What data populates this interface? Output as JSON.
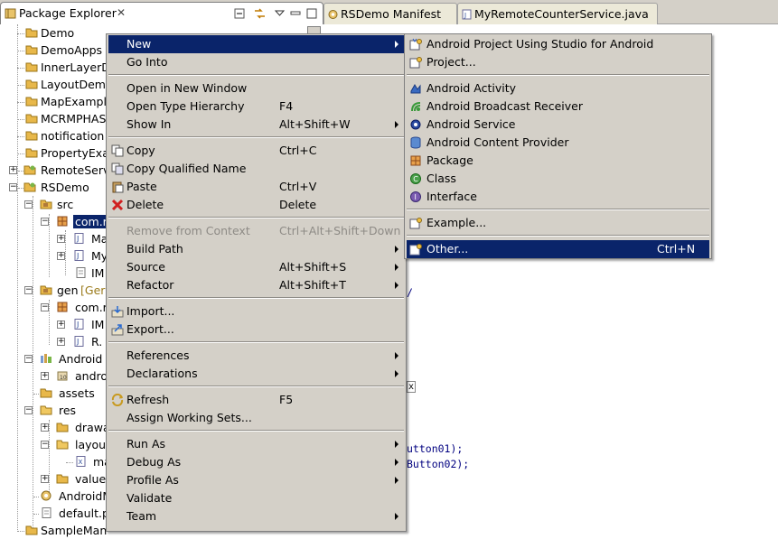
{
  "tabs": {
    "package_explorer": "Package Explorer",
    "close_glyph": "✕",
    "editor_tabs": [
      "RSDemo Manifest",
      "MyRemoteCounterService.java"
    ]
  },
  "tree": {
    "items": [
      {
        "label": "Demo"
      },
      {
        "label": "DemoApps"
      },
      {
        "label": "InnerLayerD"
      },
      {
        "label": "LayoutDemo"
      },
      {
        "label": "MapExample"
      },
      {
        "label": "MCRMPHASE"
      },
      {
        "label": "notification"
      },
      {
        "label": "PropertyExa"
      },
      {
        "label": "RemoteServ"
      },
      {
        "label": "RSDemo"
      },
      {
        "label": "src"
      },
      {
        "label": "com.r"
      },
      {
        "label": "Ma"
      },
      {
        "label": "My"
      },
      {
        "label": "IM"
      },
      {
        "label": "gen",
        "suffix": "[Ger"
      },
      {
        "label": "com.r"
      },
      {
        "label": "IM"
      },
      {
        "label": "R."
      },
      {
        "label": "Android :"
      },
      {
        "label": "andro"
      },
      {
        "label": "assets"
      },
      {
        "label": "res"
      },
      {
        "label": "drawa"
      },
      {
        "label": "layou"
      },
      {
        "label": "ma"
      },
      {
        "label": "values"
      },
      {
        "label": "AndroidM"
      },
      {
        "label": "default.p"
      },
      {
        "label": "SampleMan"
      }
    ]
  },
  "editor": {
    "code_lines": [
      "/",
      "x",
      "utton01);",
      "Button02);"
    ]
  },
  "context_menu": {
    "items": [
      {
        "label": "New",
        "accel": "",
        "submenu": true
      },
      {
        "label": "Go Into",
        "accel": ""
      },
      {
        "label": "Open in New Window",
        "accel": ""
      },
      {
        "label": "Open Type Hierarchy",
        "accel": "F4"
      },
      {
        "label": "Show In",
        "accel": "Alt+Shift+W",
        "submenu": true
      },
      {
        "label": "Copy",
        "accel": "Ctrl+C"
      },
      {
        "label": "Copy Qualified Name",
        "accel": ""
      },
      {
        "label": "Paste",
        "accel": "Ctrl+V"
      },
      {
        "label": "Delete",
        "accel": "Delete"
      },
      {
        "label": "Remove from Context",
        "accel": "Ctrl+Alt+Shift+Down",
        "disabled": true
      },
      {
        "label": "Build Path",
        "accel": "",
        "submenu": true
      },
      {
        "label": "Source",
        "accel": "Alt+Shift+S",
        "submenu": true
      },
      {
        "label": "Refactor",
        "accel": "Alt+Shift+T",
        "submenu": true
      },
      {
        "label": "Import...",
        "accel": ""
      },
      {
        "label": "Export...",
        "accel": ""
      },
      {
        "label": "References",
        "accel": "",
        "submenu": true
      },
      {
        "label": "Declarations",
        "accel": "",
        "submenu": true
      },
      {
        "label": "Refresh",
        "accel": "F5"
      },
      {
        "label": "Assign Working Sets...",
        "accel": ""
      },
      {
        "label": "Run As",
        "accel": "",
        "submenu": true
      },
      {
        "label": "Debug As",
        "accel": "",
        "submenu": true
      },
      {
        "label": "Profile As",
        "accel": "",
        "submenu": true
      },
      {
        "label": "Validate",
        "accel": ""
      },
      {
        "label": "Team",
        "accel": "",
        "submenu": true
      }
    ]
  },
  "new_submenu": {
    "items": [
      {
        "label": "Android Project Using Studio for Android",
        "accel": ""
      },
      {
        "label": "Project...",
        "accel": ""
      },
      {
        "label": "Android Activity",
        "accel": ""
      },
      {
        "label": "Android Broadcast Receiver",
        "accel": ""
      },
      {
        "label": "Android Service",
        "accel": ""
      },
      {
        "label": "Android Content Provider",
        "accel": ""
      },
      {
        "label": "Package",
        "accel": ""
      },
      {
        "label": "Class",
        "accel": ""
      },
      {
        "label": "Interface",
        "accel": ""
      },
      {
        "label": "Example...",
        "accel": ""
      },
      {
        "label": "Other...",
        "accel": "Ctrl+N"
      }
    ]
  },
  "colors": {
    "highlight": "#0a246a",
    "menu_bg": "#d4d0c8",
    "disabled": "#8e8b86",
    "folder": "#e8b84a"
  }
}
